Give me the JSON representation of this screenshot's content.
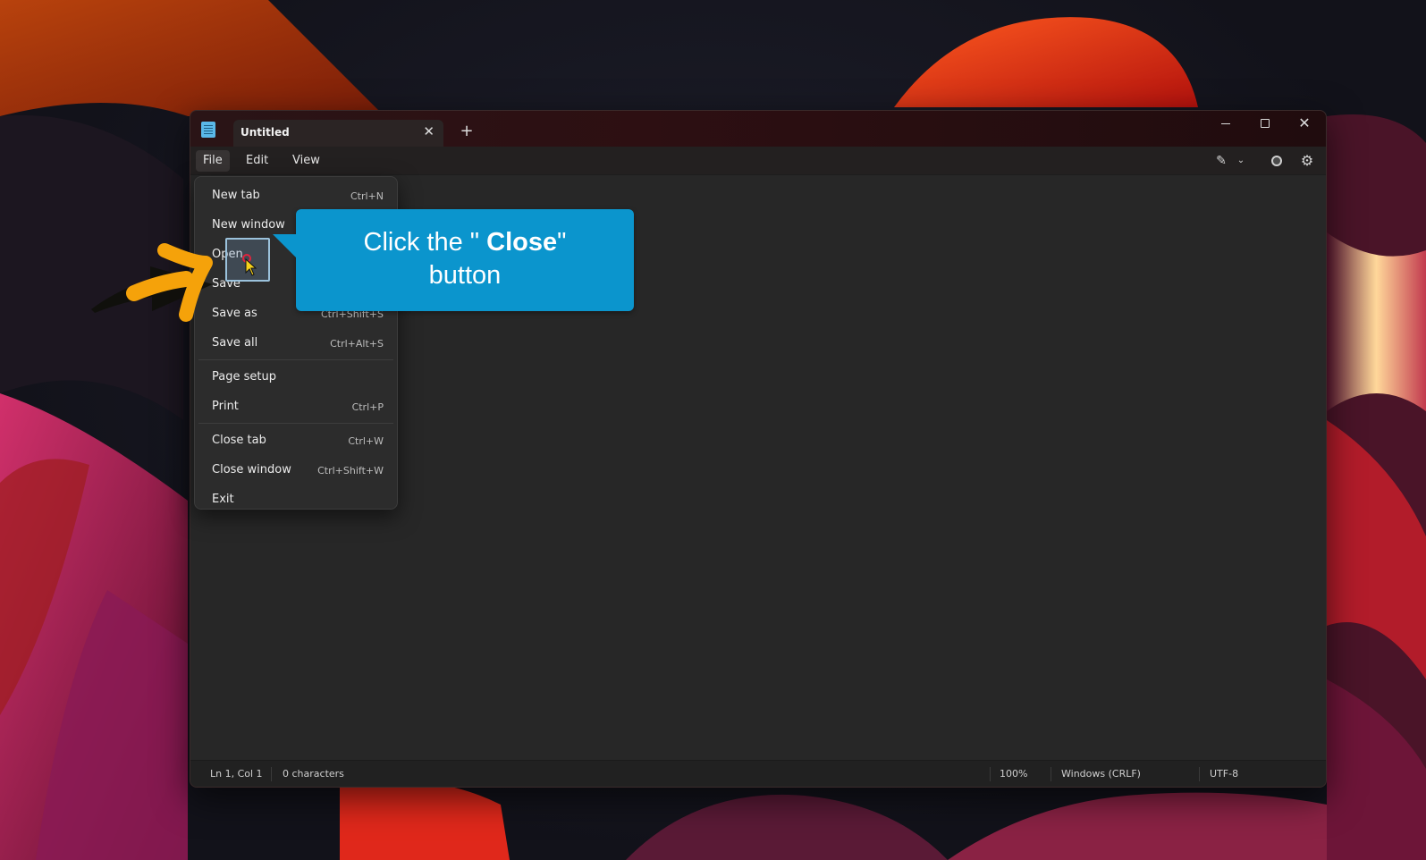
{
  "window": {
    "tab_title": "Untitled",
    "tab_close_icon": "✕",
    "new_tab_icon": "+",
    "minimize_icon": "minimize-icon",
    "maximize_icon": "maximize-icon",
    "close_icon": "✕"
  },
  "menubar": {
    "items": [
      "File",
      "Edit",
      "View"
    ],
    "copilot_icon": "✎",
    "chevron_icon": "⌄",
    "gear_icon": "⚙"
  },
  "file_menu": {
    "items": [
      {
        "label": "New tab",
        "shortcut": "Ctrl+N"
      },
      {
        "label": "New window",
        "shortcut": ""
      },
      {
        "label": "Open",
        "shortcut": ""
      },
      {
        "label": "Save",
        "shortcut": ""
      },
      {
        "label": "Save as",
        "shortcut": "Ctrl+Shift+S"
      },
      {
        "label": "Save all",
        "shortcut": "Ctrl+Alt+S"
      },
      {
        "label": "Page setup",
        "shortcut": ""
      },
      {
        "label": "Print",
        "shortcut": "Ctrl+P"
      },
      {
        "label": "Close tab",
        "shortcut": "Ctrl+W"
      },
      {
        "label": "Close window",
        "shortcut": "Ctrl+Shift+W"
      },
      {
        "label": "Exit",
        "shortcut": ""
      }
    ]
  },
  "statusbar": {
    "position": "Ln 1, Col 1",
    "characters": "0 characters",
    "zoom": "100%",
    "line_ending": "Windows (CRLF)",
    "encoding": "UTF-8"
  },
  "tutorial": {
    "line1_prefix": "Click the \" ",
    "line1_emphasis": "Close",
    "line1_suffix": "\"",
    "line2": "button"
  },
  "colors": {
    "callout": "#0b95cd",
    "arrow": "#f5a20a",
    "click_marker": "#e0243d"
  }
}
